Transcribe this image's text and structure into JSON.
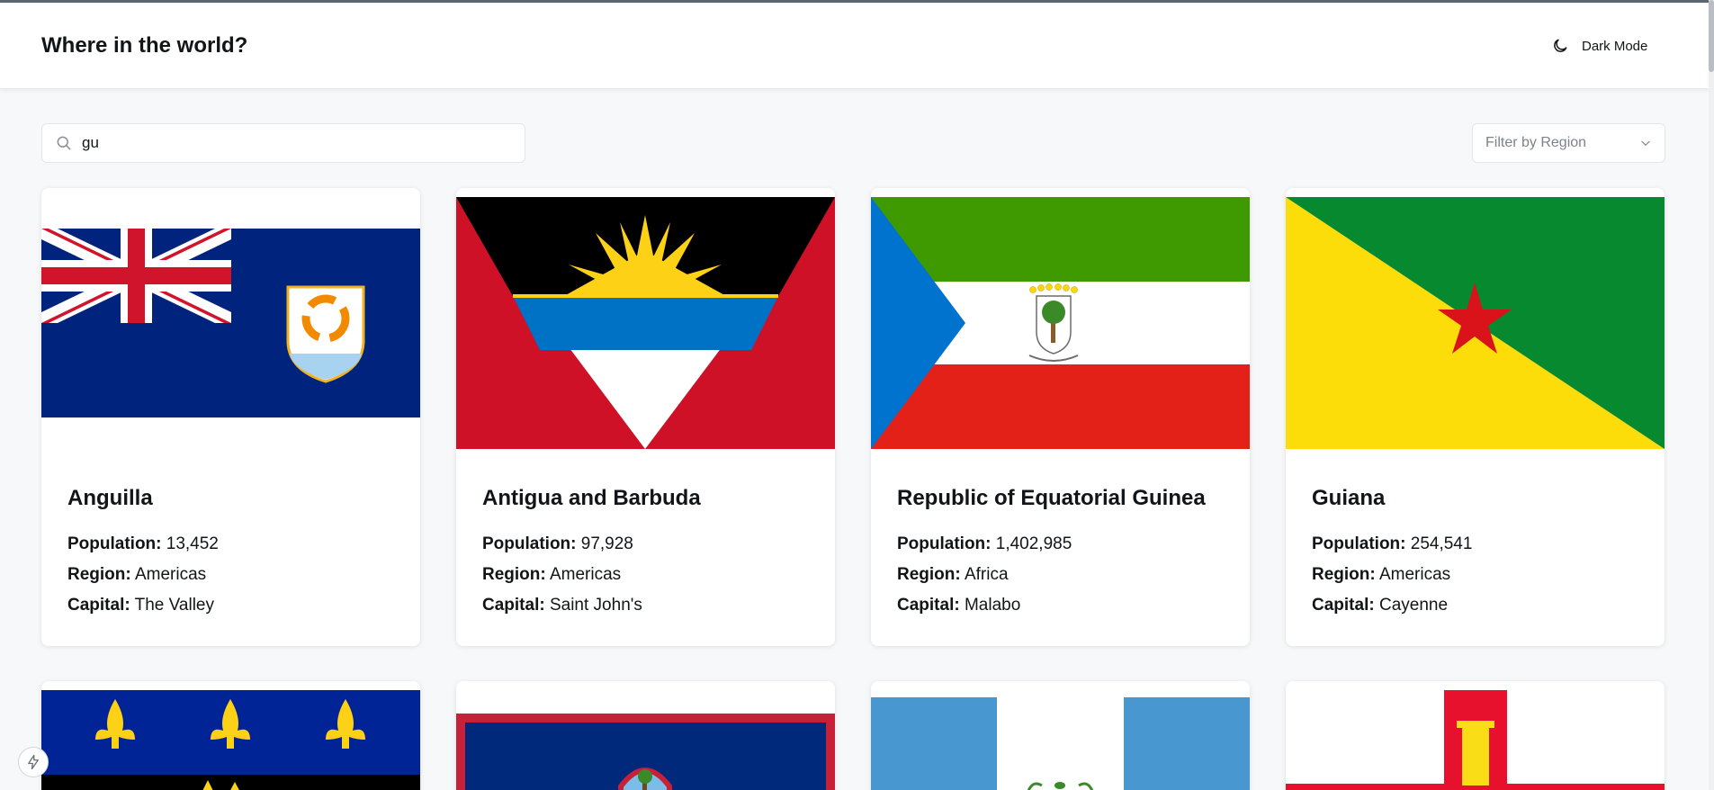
{
  "header": {
    "title": "Where in the world?",
    "mode_toggle": {
      "icon": "moon-icon",
      "label": "Dark Mode"
    }
  },
  "search": {
    "icon": "search-icon",
    "value": "gu"
  },
  "filter": {
    "placeholder": "Filter by Region",
    "icon": "chevron-down-icon"
  },
  "labels": {
    "population": "Population:",
    "region": "Region:",
    "capital": "Capital:"
  },
  "countries": [
    {
      "name": "Anguilla",
      "population": "13,452",
      "region": "Americas",
      "capital": "The Valley"
    },
    {
      "name": "Antigua and Barbuda",
      "population": "97,928",
      "region": "Americas",
      "capital": "Saint John's"
    },
    {
      "name": "Republic of Equatorial Guinea",
      "population": "1,402,985",
      "region": "Africa",
      "capital": "Malabo"
    },
    {
      "name": "Guiana",
      "population": "254,541",
      "region": "Americas",
      "capital": "Cayenne"
    }
  ],
  "colors": {
    "background": "#f7f8fa",
    "card": "#ffffff",
    "text": "#111517",
    "muted": "#7d838a"
  }
}
